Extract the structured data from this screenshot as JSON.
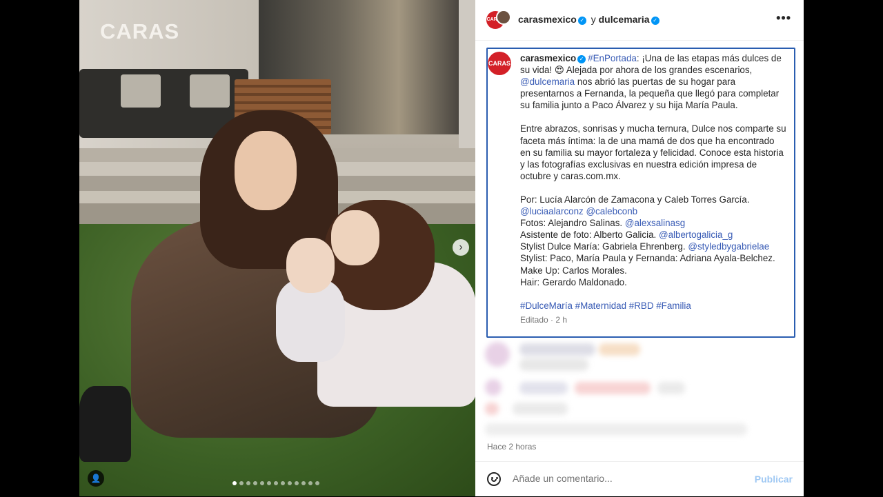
{
  "photo": {
    "logo": "CARAS",
    "slide_count": 13,
    "active_slide": 1
  },
  "header": {
    "avatar_label": "CARAS",
    "author": "carasmexico",
    "connector": "y",
    "collaborator": "dulcemaria",
    "more": "•••"
  },
  "caption": {
    "avatar_label": "CARAS",
    "author": "carasmexico",
    "hashtag_lead": "#EnPortada",
    "p1_a": ": ¡Una de las etapas más dulces de su vida! 😍 Alejada por ahora de los grandes escenarios,",
    "p1_mention": "@dulcemaria",
    "p1_b": " nos abrió las puertas de su hogar para presentarnos a Fernanda, la pequeña que llegó para completar su familia junto a Paco Álvarez y su hija María Paula.",
    "p2": "Entre abrazos, sonrisas y mucha ternura, Dulce nos comparte su faceta más íntima: la de una mamá de dos que ha encontrado en su familia su mayor fortaleza y felicidad. Conoce esta historia y las fotografías exclusivas en nuestra edición impresa de octubre y caras.com.mx.",
    "credits": {
      "by": "Por: Lucía Alarcón de Zamacona y Caleb Torres García.",
      "by_mentions": "@luciaalarconz @calebconb",
      "photos": "Fotos: Alejandro Salinas.",
      "photos_mention": "@alexsalinasg",
      "assistant": "Asistente de foto: Alberto Galicia.",
      "assistant_mention": "@albertogalicia_g",
      "stylist_dulce": "Stylist Dulce María: Gabriela Ehrenberg.",
      "stylist_dulce_mention": "@styledbygabrielae",
      "stylist_family": "Stylist: Paco, María Paula y Fernanda: Adriana Ayala-Belchez.",
      "makeup": "Make Up: Carlos Morales.",
      "hair": "Hair: Gerardo Maldonado."
    },
    "hashtags": "#DulceMaría #Maternidad #RBD #Familia",
    "edited": "Editado · 2 h"
  },
  "time_ago": "Hace 2 horas",
  "comment": {
    "placeholder": "Añade un comentario...",
    "publish": "Publicar"
  },
  "colors": {
    "link": "#385bb5",
    "verified": "#0095f6",
    "brand_red": "#d32027",
    "highlight_border": "#2a5db0",
    "publish_disabled": "#9fc8f3"
  }
}
